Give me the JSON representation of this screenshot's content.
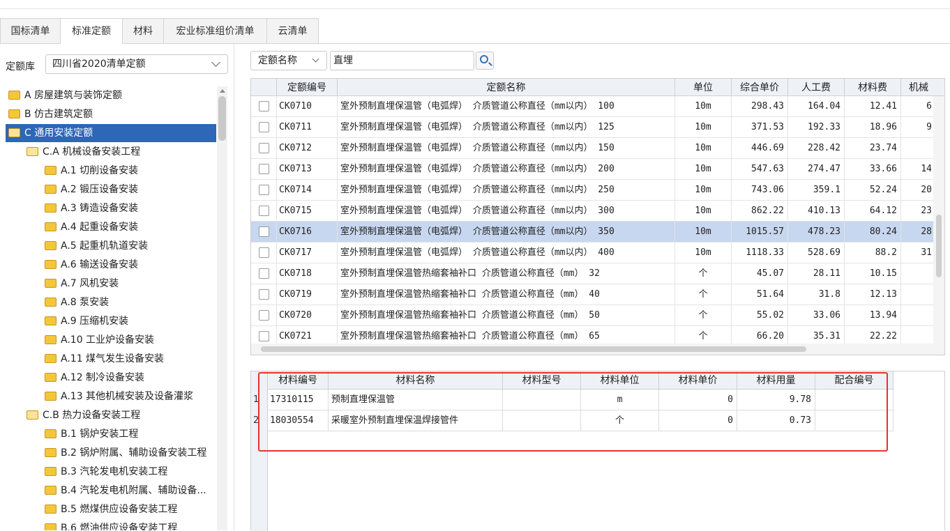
{
  "tabs": [
    "国标清单",
    "标准定额",
    "材料",
    "宏业标准组价清单",
    "云清单"
  ],
  "active_tab": "标准定额",
  "library": {
    "label": "定额库",
    "value": "四川省2020清单定额"
  },
  "tree": [
    {
      "label": "A 房屋建筑与装饰定额",
      "level": 0
    },
    {
      "label": "B 仿古建筑定额",
      "level": 0
    },
    {
      "label": "C 通用安装定额",
      "level": 0,
      "selected": true
    },
    {
      "label": "C.A 机械设备安装工程",
      "level": 1
    },
    {
      "label": "A.1 切削设备安装",
      "level": 2
    },
    {
      "label": "A.2 锻压设备安装",
      "level": 2
    },
    {
      "label": "A.3 铸造设备安装",
      "level": 2
    },
    {
      "label": "A.4 起重设备安装",
      "level": 2
    },
    {
      "label": "A.5 起重机轨道安装",
      "level": 2
    },
    {
      "label": "A.6 输送设备安装",
      "level": 2
    },
    {
      "label": "A.7 风机安装",
      "level": 2
    },
    {
      "label": "A.8 泵安装",
      "level": 2
    },
    {
      "label": "A.9 压缩机安装",
      "level": 2
    },
    {
      "label": "A.10 工业炉设备安装",
      "level": 2
    },
    {
      "label": "A.11 煤气发生设备安装",
      "level": 2
    },
    {
      "label": "A.12 制冷设备安装",
      "level": 2
    },
    {
      "label": "A.13 其他机械安装及设备灌浆",
      "level": 2
    },
    {
      "label": "C.B 热力设备安装工程",
      "level": 1
    },
    {
      "label": "B.1 锅炉安装工程",
      "level": 2
    },
    {
      "label": "B.2 锅炉附属、辅助设备安装工程",
      "level": 2
    },
    {
      "label": "B.3 汽轮发电机安装工程",
      "level": 2
    },
    {
      "label": "B.4 汽轮发电机附属、辅助设备...",
      "level": 2
    },
    {
      "label": "B.5 燃煤供应设备安装工程",
      "level": 2
    },
    {
      "label": "B.6 燃油供应设备安装工程",
      "level": 2
    }
  ],
  "search": {
    "field": "定额名称",
    "query": "直埋"
  },
  "quota_table": {
    "headers": [
      "定额编号",
      "定额名称",
      "单位",
      "综合单价",
      "人工费",
      "材料费",
      "机械"
    ],
    "rows": [
      [
        "CK0710",
        "室外预制直埋保温管（电弧焊） 介质管道公称直径（mm以内） 100",
        "10m",
        "298.43",
        "164.04",
        "12.41",
        "6"
      ],
      [
        "CK0711",
        "室外预制直埋保温管（电弧焊） 介质管道公称直径（mm以内） 125",
        "10m",
        "371.53",
        "192.33",
        "18.96",
        "9"
      ],
      [
        "CK0712",
        "室外预制直埋保温管（电弧焊） 介质管道公称直径（mm以内） 150",
        "10m",
        "446.69",
        "228.42",
        "23.74",
        ""
      ],
      [
        "CK0713",
        "室外预制直埋保温管（电弧焊） 介质管道公称直径（mm以内） 200",
        "10m",
        "547.63",
        "274.47",
        "33.66",
        "14"
      ],
      [
        "CK0714",
        "室外预制直埋保温管（电弧焊） 介质管道公称直径（mm以内） 250",
        "10m",
        "743.06",
        "359.1",
        "52.24",
        "20"
      ],
      [
        "CK0715",
        "室外预制直埋保温管（电弧焊） 介质管道公称直径（mm以内） 300",
        "10m",
        "862.22",
        "410.13",
        "64.12",
        "23"
      ],
      [
        "CK0716",
        "室外预制直埋保温管（电弧焊） 介质管道公称直径（mm以内） 350",
        "10m",
        "1015.57",
        "478.23",
        "80.24",
        "28"
      ],
      [
        "CK0717",
        "室外预制直埋保温管（电弧焊） 介质管道公称直径（mm以内） 400",
        "10m",
        "1118.33",
        "528.69",
        "88.2",
        "31"
      ],
      [
        "CK0718",
        "室外预制直埋保温管热缩套袖补口 介质管道公称直径（mm） 32",
        "个",
        "45.07",
        "28.11",
        "10.15",
        ""
      ],
      [
        "CK0719",
        "室外预制直埋保温管热缩套袖补口 介质管道公称直径（mm） 40",
        "个",
        "51.64",
        "31.8",
        "12.13",
        ""
      ],
      [
        "CK0720",
        "室外预制直埋保温管热缩套袖补口 介质管道公称直径（mm） 50",
        "个",
        "55.02",
        "33.06",
        "13.94",
        ""
      ],
      [
        "CK0721",
        "室外预制直埋保温管热缩套袖补口 介质管道公称直径（mm） 65",
        "个",
        "66.20",
        "35.31",
        "22.22",
        ""
      ]
    ],
    "selected_row": 6
  },
  "material_table": {
    "headers": [
      "材料编号",
      "材料名称",
      "材料型号",
      "材料单位",
      "材料单价",
      "材料用量",
      "配合编号"
    ],
    "rows": [
      [
        "1",
        "17310115",
        "预制直埋保温管",
        "",
        "m",
        "0",
        "9.78",
        ""
      ],
      [
        "2",
        "18030554",
        "采暖室外预制直埋保温焊接管件",
        "",
        "个",
        "0",
        "0.73",
        ""
      ]
    ]
  }
}
